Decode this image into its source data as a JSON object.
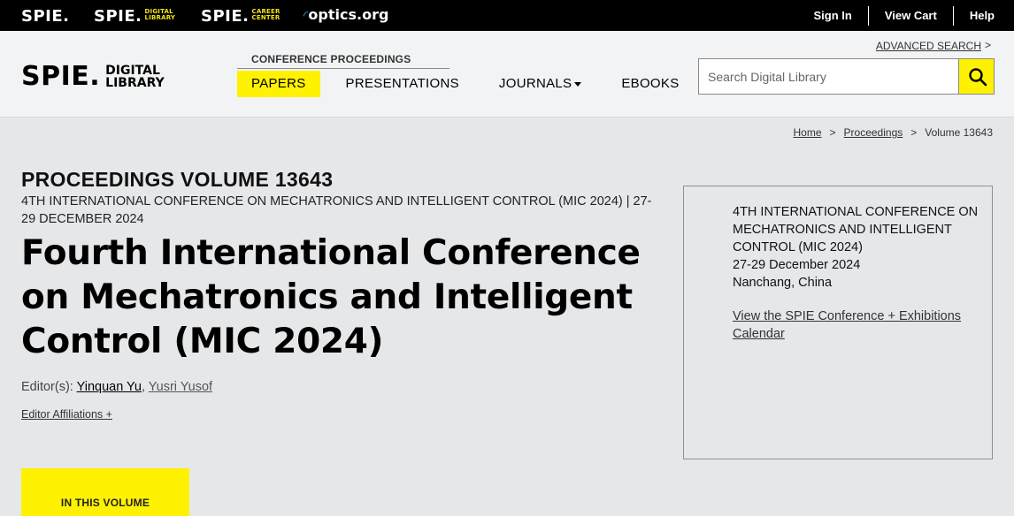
{
  "topbar": {
    "brands": [
      {
        "name": "SPIE.",
        "sub": ""
      },
      {
        "name": "SPIE.",
        "sub_line1": "DIGITAL",
        "sub_line2": "LIBRARY"
      },
      {
        "name": "SPIE.",
        "sub_line1": "CAREER",
        "sub_line2": "CENTER"
      }
    ],
    "optics": "optics.org",
    "links": [
      "Sign In",
      "View Cart",
      "Help"
    ]
  },
  "header": {
    "logo": {
      "spie": "SPIE.",
      "line1": "DIGITAL",
      "line2": "LIBRARY"
    },
    "conf_label": "CONFERENCE PROCEEDINGS",
    "nav": [
      "PAPERS",
      "PRESENTATIONS",
      "JOURNALS",
      "EBOOKS"
    ],
    "advanced_search": "ADVANCED SEARCH",
    "search_placeholder": "Search Digital Library"
  },
  "breadcrumb": [
    "Home",
    "Proceedings",
    "Volume 13643"
  ],
  "main": {
    "volume": "PROCEEDINGS VOLUME 13643",
    "subconf": "4TH INTERNATIONAL CONFERENCE ON MECHATRONICS AND INTELLIGENT CONTROL (MIC 2024) | 27-29 DECEMBER 2024",
    "title": "Fourth International Conference on Mechatronics and Intelligent Control (MIC 2024)",
    "editors_label": "Editor(s): ",
    "editors": [
      "Yinquan Yu",
      "Yusri Yusof"
    ],
    "affiliations": "Editor Affiliations +",
    "in_this_volume": "IN THIS VOLUME"
  },
  "sidebox": {
    "conf_name": "4TH INTERNATIONAL CONFERENCE ON MECHATRONICS AND INTELLIGENT CONTROL (MIC 2024)",
    "dates": "27-29 December 2024",
    "location": "Nanchang, China",
    "calendar_link": "View the SPIE Conference + Exhibitions Calendar"
  },
  "colors": {
    "accent": "#fff200",
    "topbar": "#000000",
    "header_bg": "#f2f3f4",
    "page_bg": "#e6e7e9"
  }
}
